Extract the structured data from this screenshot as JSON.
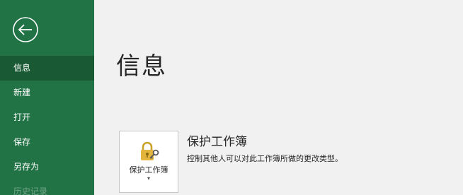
{
  "sidebar": {
    "accent_color": "#217346",
    "active_color": "#195a35",
    "back_icon": "back-arrow-circle-icon",
    "items": [
      {
        "label": "信息"
      },
      {
        "label": "新建"
      },
      {
        "label": "打开"
      },
      {
        "label": "保存"
      },
      {
        "label": "另存为"
      },
      {
        "label": "历史记录"
      }
    ]
  },
  "main": {
    "page_title": "信息",
    "protect_workbook": {
      "icon": "lock-key-icon",
      "button_label": "保护工作簿",
      "dropdown_caret": "▾",
      "title": "保护工作簿",
      "description": "控制其他人可以对此工作簿所做的更改类型。"
    }
  }
}
